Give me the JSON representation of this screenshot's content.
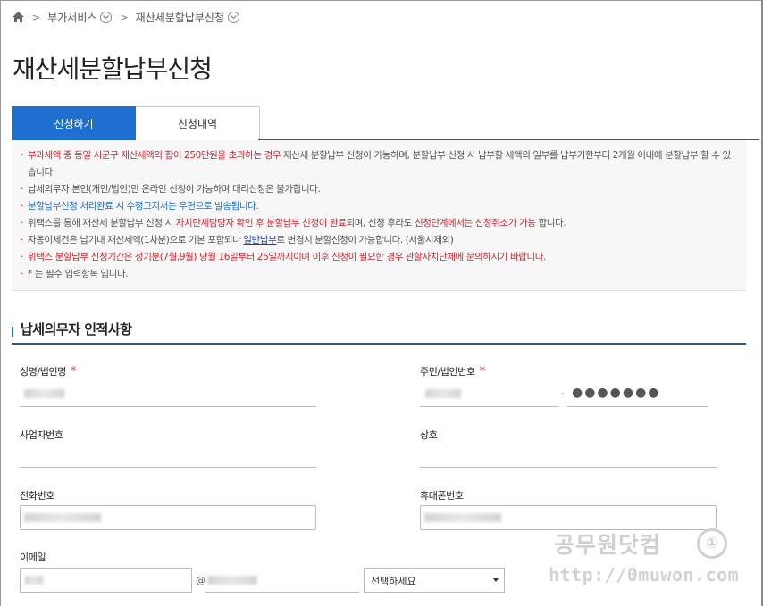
{
  "breadcrumb": {
    "home_icon": "home-icon",
    "items": [
      {
        "label": "부가서비스"
      },
      {
        "label": "재산세분할납부신청"
      }
    ]
  },
  "page_title": "재산세분할납부신청",
  "tabs": [
    {
      "label": "신청하기",
      "active": true
    },
    {
      "label": "신청내역",
      "active": false
    }
  ],
  "notices": {
    "n1_red": "부과세액 중 동일 시군구 재산세액의 합이 250만원을 초과하는 경우",
    "n1_rest": " 재산세 분할납부 신청이 가능하며, 분할납부 신청 시 납부할 세액의 일부를 납부기한부터 2개월 이내에 분할납부 할 수 있습니다.",
    "n2": "납세의무자 본인(개인/법인)만 온라인 신청이 가능하며 대리신청은 불가합니다.",
    "n3_blue": "분할납부신청 처리완료 시 수정고지서는 우편으로 발송됩니다.",
    "n4_a": "위택스를 통해 재산세 분할납부 신청 시 ",
    "n4_red1": "자치단체담당자 확인 후 분할납부 신청이 완료",
    "n4_b": "되며, 신청 후라도 ",
    "n4_red2": "신청단계에서는 신청취소가 가능",
    "n4_c": " 합니다.",
    "n5_a": "자동이체건은 납기내 재산세액(1차분)으로 기본 포함되나 ",
    "n5_link": "일반납부",
    "n5_b": "로 변경시 분할신청이 가능합니다. (서울시제외)",
    "n6_red": "위택스 분할납부 신청기간은 정기분(7월,9월) 당월 16일부터 25일까지이며 이후 신청이 필요한 경우 관할자치단체에 문의하시기 바랍니다.",
    "n7_star": "*",
    "n7_rest": " 는 필수 입력항목 입니다."
  },
  "section": {
    "title": "납세의무자 인적사항"
  },
  "form": {
    "name_label": "성명/법인명",
    "id_label": "주민/법인번호",
    "id_masked": "●●●●●●●",
    "id_dash": "-",
    "biz_label": "사업자번호",
    "company_label": "상호",
    "phone_label": "전화번호",
    "mobile_label": "휴대폰번호",
    "email_label": "이메일",
    "email_at": "@",
    "email_select": "선택하세요",
    "required_star": "*"
  },
  "watermark": {
    "text": "공무원닷컴",
    "logo": "①",
    "url": "http://0muwon.com"
  },
  "colors": {
    "accent": "#1f6fd1",
    "required": "#d9232d"
  }
}
